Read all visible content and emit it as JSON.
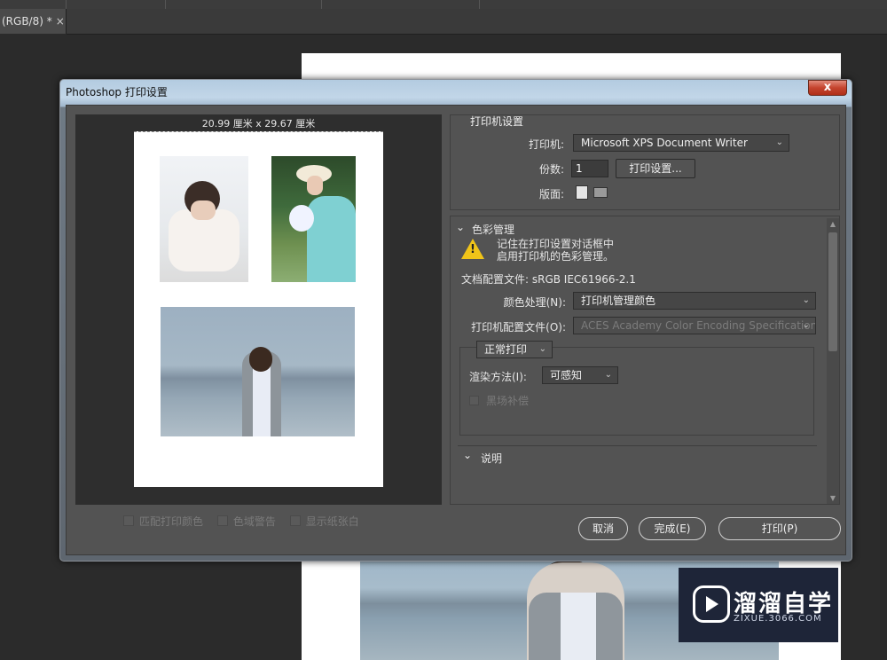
{
  "app": {
    "doc_tab": "(RGB/8) *",
    "doc_tab_close": "×"
  },
  "watermark": {
    "brand": "溜溜自学",
    "url": "ZIXUE.3066.COM"
  },
  "dialog": {
    "title": "Photoshop 打印设置",
    "close": "x",
    "preview": {
      "dimensions": "20.99 厘米 x 29.67 厘米"
    },
    "checkboxes": [
      {
        "label": "匹配打印颜色",
        "checked": false
      },
      {
        "label": "色域警告",
        "checked": false
      },
      {
        "label": "显示纸张白",
        "checked": false
      }
    ],
    "printer_settings": {
      "title": "打印机设置",
      "printer_label": "打印机:",
      "printer_value": "Microsoft XPS Document Writer",
      "copies_label": "份数:",
      "copies_value": "1",
      "setup_button": "打印设置...",
      "layout_label": "版面:"
    },
    "color_management": {
      "title": "色彩管理",
      "warning_line1": "记住在打印设置对话框中",
      "warning_line2": "启用打印机的色彩管理。",
      "doc_profile": "文档配置文件: sRGB IEC61966-2.1",
      "color_handling_label": "颜色处理(N):",
      "color_handling_value": "打印机管理颜色",
      "printer_profile_label": "打印机配置文件(O):",
      "printer_profile_value": "ACES Academy Color Encoding Specification...",
      "print_mode": "正常打印",
      "render_intent_label": "渲染方法(I):",
      "render_intent_value": "可感知",
      "black_point": "黑场补偿",
      "description": "说明"
    },
    "buttons": {
      "cancel": "取消",
      "done": "完成(E)",
      "print": "打印(P)"
    }
  }
}
